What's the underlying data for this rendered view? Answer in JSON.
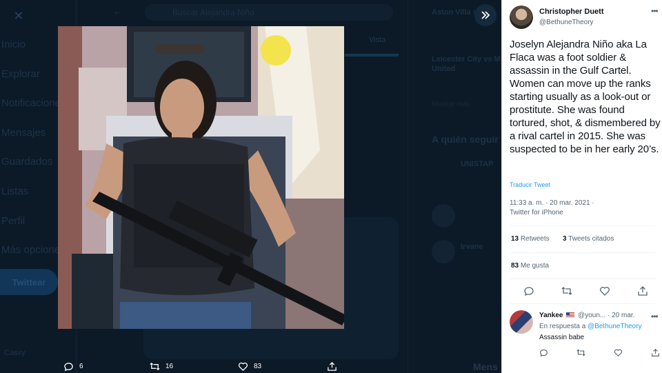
{
  "background": {
    "search_placeholder": "Buscar Alejandra Niño",
    "nav": [
      "Inicio",
      "Explorar",
      "Notificaciones",
      "Mensajes",
      "Guardados",
      "Listas",
      "Perfil",
      "Más opciones"
    ],
    "tweet_button": "Twittear",
    "account_name": "Casxy",
    "view_tab": "Vista",
    "right": {
      "trend1": "Aston Villa vs M",
      "trend2a": "Leicester City vs M",
      "trend2b": "United",
      "show_more": "Mostrar más",
      "who_to_follow": "A quién seguir",
      "suggest1": "UNISTAP",
      "suggest2": "Irvane"
    },
    "messages_label": "Mens"
  },
  "media_actions": {
    "replies": "6",
    "retweets": "16",
    "likes": "83"
  },
  "tweet": {
    "author_name": "Christopher Duett",
    "author_handle": "@BethuneTheory",
    "text": "Joselyn Alejandra Niño aka La Flaca was a foot soldier & assassin in the Gulf Cartel. Women can move up the ranks starting usually as a look-out or prostitute. She was found tortured, shot, & dismembered by a rival cartel in 2015. She was suspected to be in her early 20’s.",
    "translate": "Traducir Tweet",
    "time": "11:33 a. m. · 20 mar. 2021 ·",
    "source": "Twitter for iPhone",
    "retweets_count": "13",
    "retweets_label": "Retweets",
    "quotes_count": "3",
    "quotes_label": "Tweets citados",
    "likes_count": "83",
    "likes_label": "Me gusta"
  },
  "reply": {
    "name": "Yankee",
    "handle": "@youn...",
    "date": "· 20 mar.",
    "in_reply_prefix": "En respuesta a",
    "in_reply_handle": "@BethuneTheory",
    "text": "Assassin babe"
  },
  "colors": {
    "overlay_bg": "#0c1a28",
    "link": "#1d9bf0",
    "secondary_text": "#536471",
    "panel_bg": "#ffffff"
  }
}
